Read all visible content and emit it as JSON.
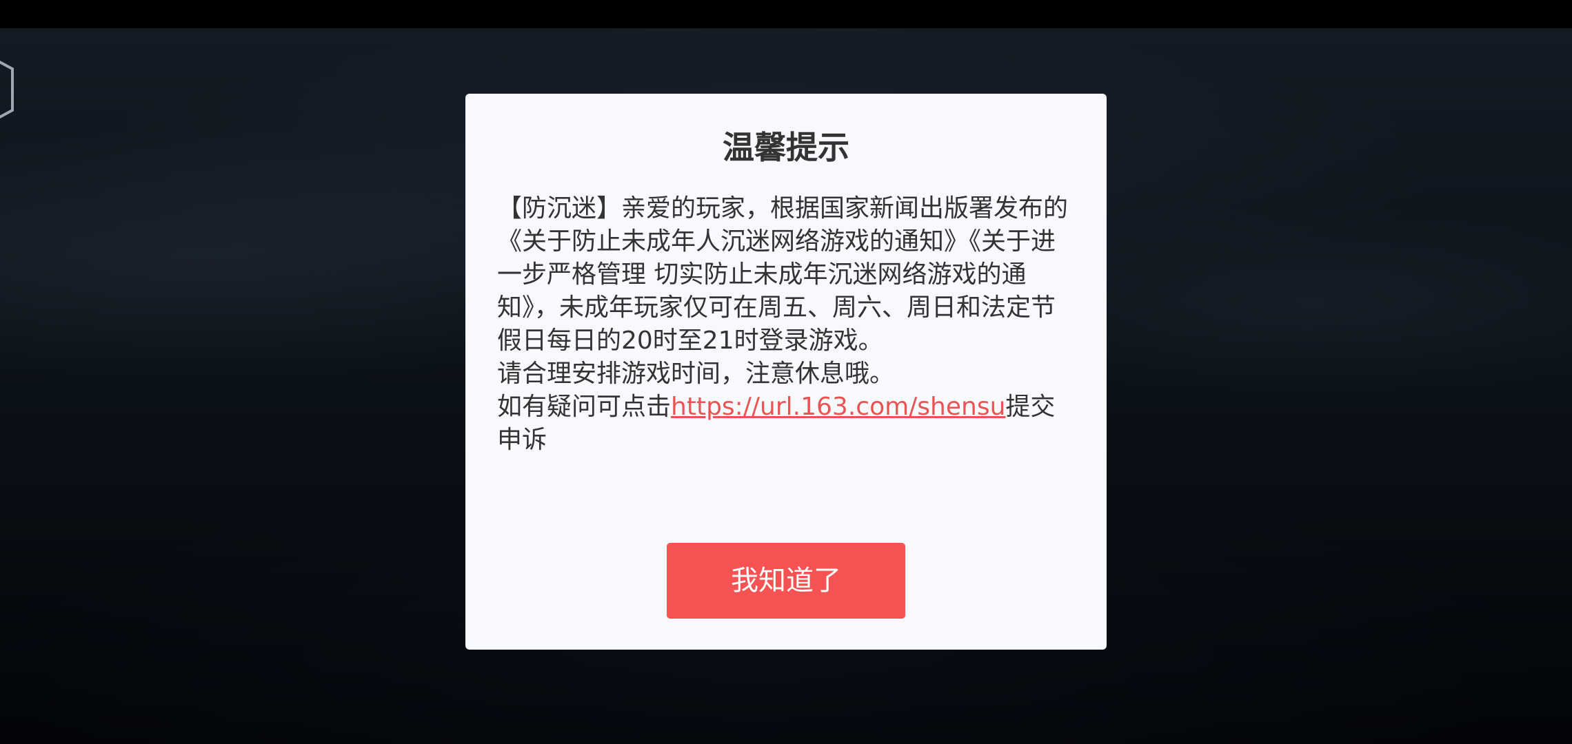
{
  "dialog": {
    "title": "温馨提示",
    "body_intro": "【防沉迷】亲爱的玩家，根据国家新闻出版署发布的《关于防止未成年人沉迷网络游戏的通知》《关于进一步严格管理 切实防止未成年沉迷网络游戏的通知》，未成年玩家仅可在周五、周六、周日和法定节假日每日的20时至21时登录游戏。",
    "body_advice": "请合理安排游戏时间，注意休息哦。",
    "appeal_prefix": "如有疑问可点击",
    "appeal_link": "https://url.163.com/shensu",
    "appeal_suffix": "提交申诉",
    "confirm_label": "我知道了"
  },
  "colors": {
    "dialog_background": "#f7f9fd",
    "confirm_button": "#f55353",
    "link": "#e85454",
    "text": "#333333"
  },
  "icons": {
    "corner_button": "hexagon-icon"
  }
}
